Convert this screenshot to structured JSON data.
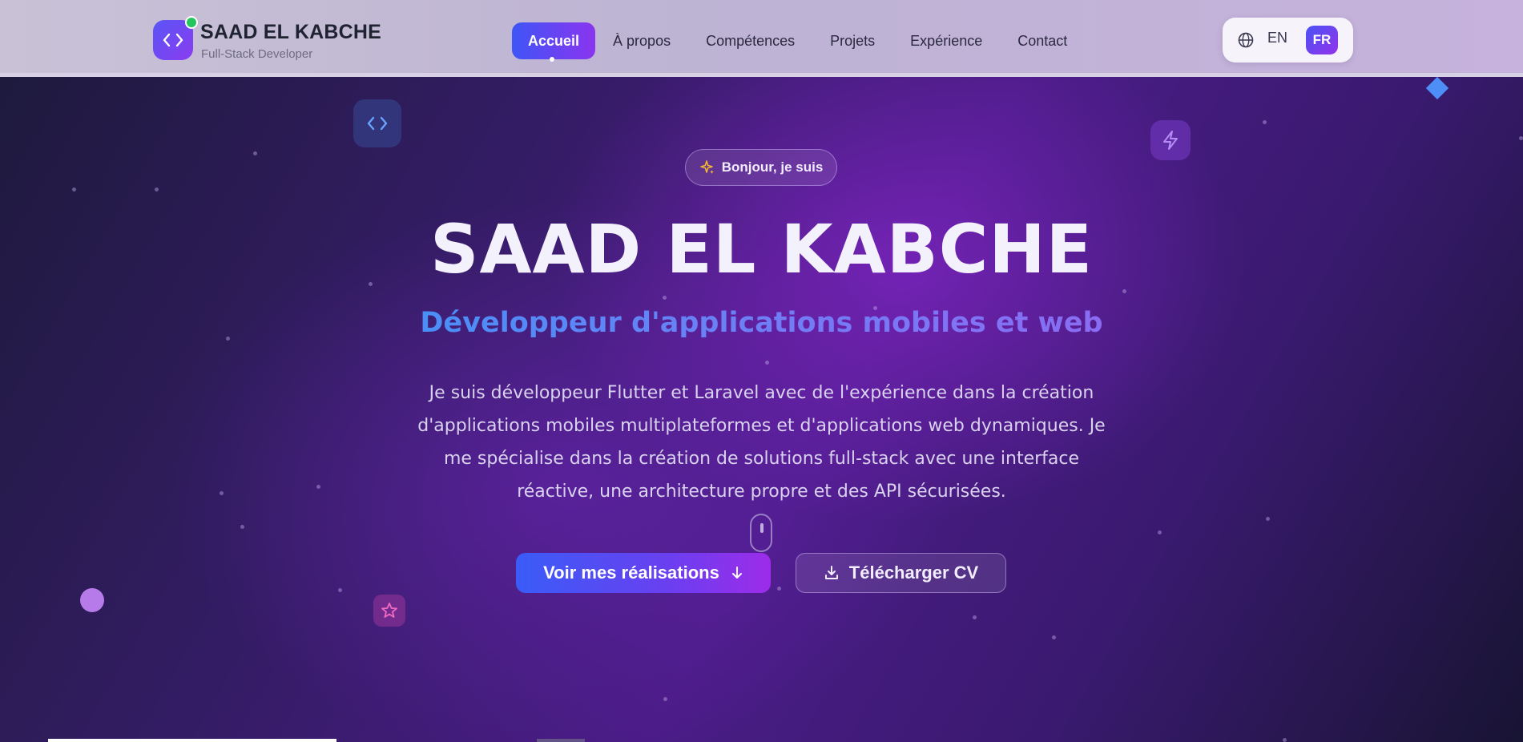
{
  "brand": {
    "name": "SAAD EL KABCHE",
    "subtitle": "Full-Stack Developer",
    "logo_icon": "code-icon",
    "status_color": "#22c55e"
  },
  "nav": {
    "items": [
      {
        "label": "Accueil",
        "active": true
      },
      {
        "label": "À propos",
        "active": false
      },
      {
        "label": "Compétences",
        "active": false
      },
      {
        "label": "Projets",
        "active": false
      },
      {
        "label": "Expérience",
        "active": false
      },
      {
        "label": "Contact",
        "active": false
      }
    ]
  },
  "language": {
    "icon": "globe-icon",
    "options": [
      "EN",
      "FR"
    ],
    "selected": "FR"
  },
  "hero": {
    "greeting": "Bonjour, je suis",
    "greeting_icon": "sparkles-icon",
    "name": "SAAD EL KABCHE",
    "role": "Développeur d'applications mobiles et web",
    "description": "Je suis développeur Flutter et Laravel avec de l'expérience dans la création d'applications mobiles multiplateformes et d'applications web dynamiques. Je me spécialise dans la création de solutions full-stack avec une interface réactive, une architecture propre et des API sécurisées.",
    "primary_button": "Voir mes réalisations",
    "secondary_button": "Télécharger CV"
  },
  "colors": {
    "accent_start": "#3f55f7",
    "accent_end": "#8a35ee",
    "role_text": "#5b8ff5"
  }
}
